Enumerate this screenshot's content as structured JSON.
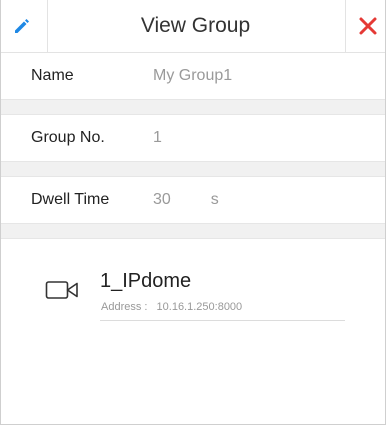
{
  "header": {
    "title": "View Group",
    "edit_icon": "pencil-icon",
    "close_icon": "close-icon",
    "accent_color": "#1e88e5",
    "close_color": "#e53935"
  },
  "fields": {
    "name": {
      "label": "Name",
      "value": "My Group1"
    },
    "group_no": {
      "label": "Group No.",
      "value": "1"
    },
    "dwell_time": {
      "label": "Dwell Time",
      "value": "30",
      "unit": "s"
    }
  },
  "devices": [
    {
      "name": "1_IPdome",
      "address_label": "Address :",
      "address_value": "10.16.1.250:8000",
      "icon": "camera-icon"
    }
  ]
}
